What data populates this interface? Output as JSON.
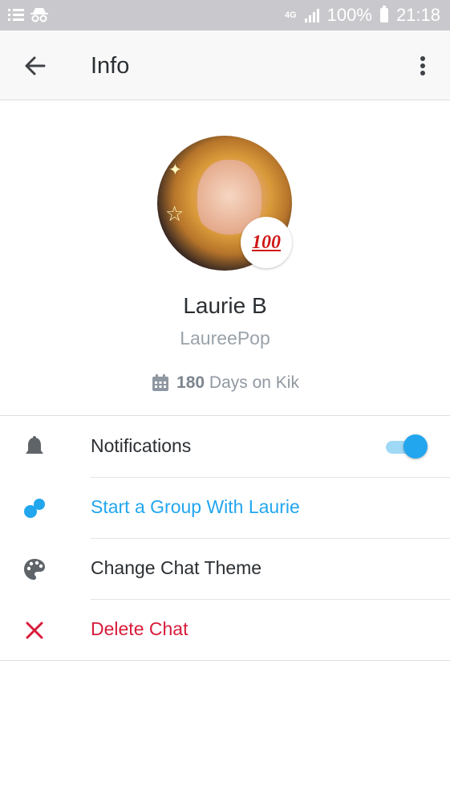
{
  "status_bar": {
    "network": "4G",
    "battery": "100%",
    "time": "21:18",
    "icons": [
      "list-icon",
      "incognito-icon",
      "signal-icon",
      "battery-icon"
    ]
  },
  "header": {
    "title": "Info",
    "back_icon": "arrow-left-icon",
    "menu_icon": "more-vertical-icon"
  },
  "profile": {
    "name": "Laurie B",
    "username": "LaureePop",
    "badge": "100",
    "days_count": "180",
    "days_suffix": "Days on Kik",
    "days_icon": "calendar-icon"
  },
  "menu": {
    "notifications": {
      "label": "Notifications",
      "icon": "bell-icon",
      "enabled": true
    },
    "start_group": {
      "label": "Start a Group With Laurie",
      "icon": "group-icon",
      "color": "#22a6ee"
    },
    "change_theme": {
      "label": "Change Chat Theme",
      "icon": "palette-icon"
    },
    "delete_chat": {
      "label": "Delete Chat",
      "icon": "close-icon",
      "color": "#d81b3a"
    }
  },
  "colors": {
    "accent": "#22a6ee",
    "danger": "#d81b3a",
    "text": "#2b2f33",
    "muted": "#9aa2aa"
  }
}
